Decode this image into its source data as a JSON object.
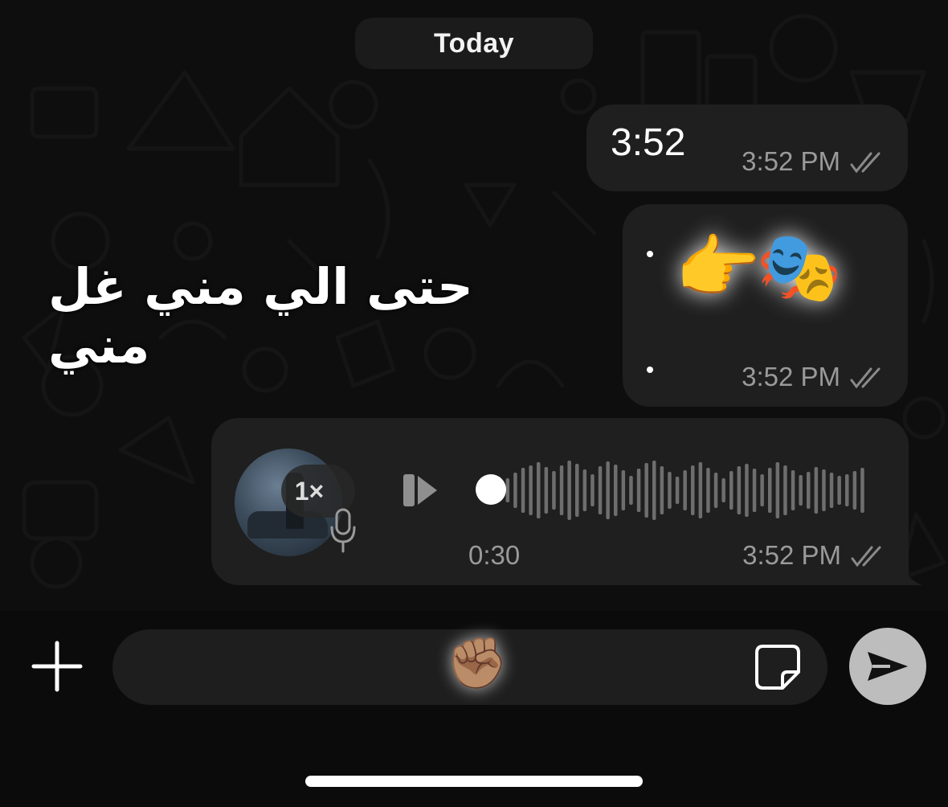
{
  "date_separator": "Today",
  "messages": [
    {
      "type": "text",
      "text": "3:52",
      "time": "3:52 PM",
      "status": "read"
    },
    {
      "type": "emoji",
      "text": "👉🎭",
      "time": "3:52 PM",
      "status": "read"
    },
    {
      "type": "voice",
      "duration": "0:30",
      "speed": "1×",
      "time": "3:52 PM",
      "status": "read"
    }
  ],
  "overlay_caption": "حتى الي مني غل مني",
  "composer": {
    "emoji": "✊🏽"
  },
  "icons": [
    "plus-icon",
    "sticker-icon",
    "send-icon",
    "mic-icon",
    "play-icon",
    "double-check-icon"
  ],
  "colors": {
    "background": "#0e0e0e",
    "bubble": "#1f1f1f",
    "meta_text": "#9a9a9a",
    "send_button": "#bdbdbd"
  }
}
